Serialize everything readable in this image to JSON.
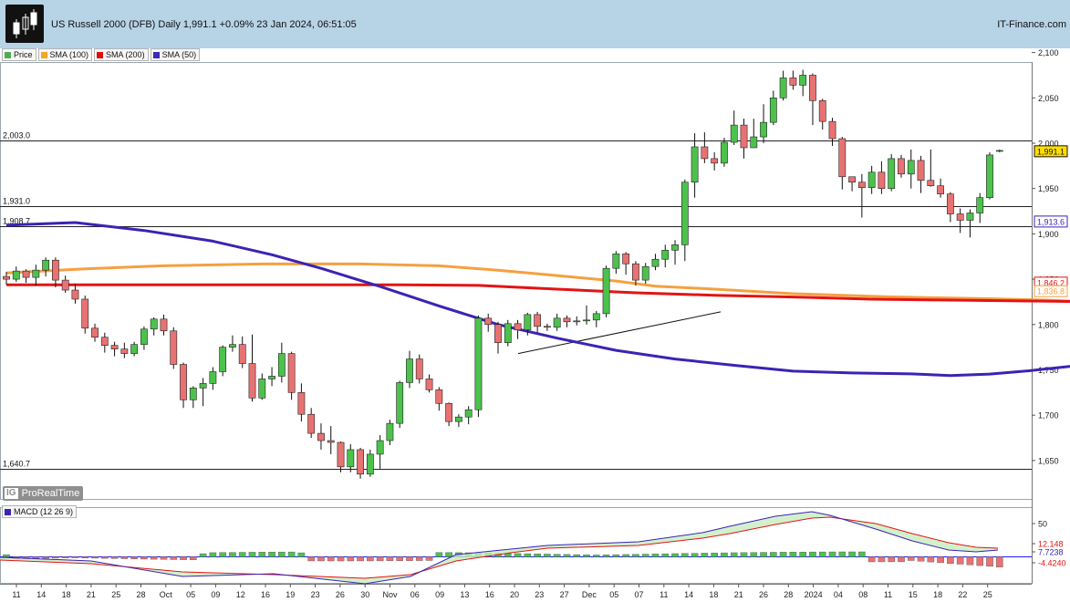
{
  "header": {
    "title": "US Russell 2000 (DFB) Daily 1,991.1 +0.09% 23 Jan 2024, 06:51:05",
    "brand": "IT-Finance.com"
  },
  "legend": [
    {
      "label": "Price",
      "color": "#4caf50"
    },
    {
      "label": "SMA (100)",
      "color": "#f5a623"
    },
    {
      "label": "SMA (200)",
      "color": "#e01010"
    },
    {
      "label": "SMA (50)",
      "color": "#3b2bb5"
    }
  ],
  "watermark": {
    "badge": "IG",
    "text": "ProRealTime"
  },
  "macd_label": "MACD (12 26 9)",
  "colors": {
    "up": "#4cc24c",
    "down": "#e87272",
    "sma50": "#3b23b4",
    "sma100": "#f5a040",
    "sma200": "#e31414"
  },
  "chart_data": [
    {
      "type": "candlestick",
      "title": "US Russell 2000 (DFB) Daily",
      "y_range": [
        1620,
        2120
      ],
      "y_ticks": [
        "2,100",
        "2,050",
        "2,000",
        "1,950",
        "1,900",
        "1,850",
        "1,800",
        "1,750",
        "1,700",
        "1,650"
      ],
      "x_ticks": [
        "11",
        "14",
        "18",
        "21",
        "25",
        "28",
        "Oct",
        "05",
        "09",
        "12",
        "16",
        "19",
        "23",
        "26",
        "30",
        "Nov",
        "06",
        "09",
        "13",
        "16",
        "20",
        "23",
        "27",
        "Dec",
        "05",
        "07",
        "11",
        "14",
        "18",
        "21",
        "26",
        "28",
        "2024",
        "04",
        "08",
        "11",
        "15",
        "18",
        "22",
        "25"
      ],
      "horizontal_levels": [
        {
          "label": "2,003.0",
          "value": 2003.0
        },
        {
          "label": "1,931.0",
          "value": 1931.0
        },
        {
          "label": "1,908.7",
          "value": 1908.7
        },
        {
          "label": "1,640.7",
          "value": 1640.7
        }
      ],
      "right_labels": [
        {
          "text": "1,991.1",
          "value": 1991.1
        },
        {
          "text": "1,913.6",
          "value": 1913.6
        },
        {
          "text": "1,846.2",
          "value": 1846.2
        },
        {
          "text": "1,836.8",
          "value": 1836.8
        }
      ],
      "trendline": [
        [
          1768,
          1812
        ],
        [
          1766,
          1816
        ]
      ],
      "candles": [
        [
          1853,
          1850,
          1858,
          1844
        ],
        [
          1850,
          1859,
          1864,
          1847
        ],
        [
          1859,
          1852,
          1861,
          1846
        ],
        [
          1852,
          1860,
          1866,
          1843
        ],
        [
          1860,
          1871,
          1874,
          1853
        ],
        [
          1871,
          1849,
          1874,
          1841
        ],
        [
          1849,
          1838,
          1854,
          1835
        ],
        [
          1838,
          1828,
          1845,
          1823
        ],
        [
          1828,
          1796,
          1832,
          1790
        ],
        [
          1796,
          1786,
          1801,
          1781
        ],
        [
          1786,
          1777,
          1791,
          1769
        ],
        [
          1777,
          1773,
          1781,
          1765
        ],
        [
          1773,
          1768,
          1780,
          1763
        ],
        [
          1768,
          1778,
          1781,
          1765
        ],
        [
          1778,
          1795,
          1798,
          1772
        ],
        [
          1795,
          1806,
          1808,
          1788
        ],
        [
          1806,
          1793,
          1811,
          1788
        ],
        [
          1793,
          1756,
          1797,
          1751
        ],
        [
          1756,
          1717,
          1758,
          1708
        ],
        [
          1717,
          1730,
          1732,
          1708
        ],
        [
          1730,
          1735,
          1741,
          1710
        ],
        [
          1735,
          1748,
          1753,
          1728
        ],
        [
          1748,
          1775,
          1777,
          1743
        ],
        [
          1775,
          1778,
          1788,
          1770
        ],
        [
          1778,
          1757,
          1787,
          1752
        ],
        [
          1757,
          1719,
          1789,
          1715
        ],
        [
          1719,
          1740,
          1746,
          1717
        ],
        [
          1740,
          1743,
          1753,
          1732
        ],
        [
          1743,
          1768,
          1780,
          1736
        ],
        [
          1768,
          1725,
          1770,
          1717
        ],
        [
          1725,
          1701,
          1735,
          1693
        ],
        [
          1701,
          1680,
          1708,
          1675
        ],
        [
          1680,
          1672,
          1691,
          1662
        ],
        [
          1672,
          1670,
          1688,
          1657
        ],
        [
          1670,
          1643,
          1671,
          1637
        ],
        [
          1643,
          1662,
          1668,
          1637
        ],
        [
          1662,
          1635,
          1664,
          1630
        ],
        [
          1635,
          1657,
          1662,
          1632
        ],
        [
          1657,
          1672,
          1678,
          1641
        ],
        [
          1672,
          1691,
          1695,
          1667
        ],
        [
          1691,
          1736,
          1738,
          1686
        ],
        [
          1736,
          1762,
          1771,
          1730
        ],
        [
          1762,
          1740,
          1767,
          1735
        ],
        [
          1740,
          1728,
          1745,
          1725
        ],
        [
          1728,
          1713,
          1731,
          1705
        ],
        [
          1713,
          1693,
          1714,
          1688
        ],
        [
          1693,
          1698,
          1701,
          1687
        ],
        [
          1698,
          1706,
          1710,
          1690
        ],
        [
          1706,
          1807,
          1810,
          1698
        ],
        [
          1807,
          1800,
          1812,
          1792
        ],
        [
          1800,
          1780,
          1803,
          1768
        ],
        [
          1780,
          1801,
          1805,
          1776
        ],
        [
          1801,
          1794,
          1805,
          1784
        ],
        [
          1794,
          1811,
          1813,
          1788
        ],
        [
          1811,
          1798,
          1814,
          1791
        ],
        [
          1798,
          1797,
          1801,
          1793
        ],
        [
          1797,
          1807,
          1812,
          1793
        ],
        [
          1807,
          1803,
          1810,
          1797
        ],
        [
          1803,
          1804,
          1809,
          1799
        ],
        [
          1804,
          1805,
          1821,
          1800
        ],
        [
          1805,
          1812,
          1815,
          1797
        ],
        [
          1812,
          1862,
          1865,
          1808
        ],
        [
          1862,
          1878,
          1881,
          1856
        ],
        [
          1878,
          1867,
          1880,
          1855
        ],
        [
          1867,
          1849,
          1870,
          1843
        ],
        [
          1849,
          1864,
          1868,
          1845
        ],
        [
          1864,
          1872,
          1878,
          1860
        ],
        [
          1872,
          1882,
          1888,
          1863
        ],
        [
          1882,
          1888,
          1893,
          1866
        ],
        [
          1888,
          1957,
          1960,
          1870
        ],
        [
          1957,
          1996,
          2011,
          1940
        ],
        [
          1996,
          1983,
          2012,
          1978
        ],
        [
          1983,
          1978,
          1990,
          1970
        ],
        [
          1978,
          2001,
          2006,
          1974
        ],
        [
          2001,
          2020,
          2036,
          1998
        ],
        [
          2020,
          1995,
          2027,
          1983
        ],
        [
          1995,
          2007,
          2027,
          2001
        ],
        [
          2007,
          2023,
          2043,
          2000
        ],
        [
          2023,
          2050,
          2058,
          2020
        ],
        [
          2050,
          2072,
          2080,
          2047
        ],
        [
          2072,
          2064,
          2080,
          2059
        ],
        [
          2064,
          2075,
          2081,
          2052
        ],
        [
          2075,
          2047,
          2077,
          2020
        ],
        [
          2047,
          2024,
          2049,
          2015
        ],
        [
          2024,
          2005,
          2028,
          1997
        ],
        [
          2005,
          1963,
          2007,
          1949
        ],
        [
          1963,
          1957,
          1961,
          1947
        ],
        [
          1957,
          1951,
          1966,
          1918
        ],
        [
          1951,
          1968,
          1975,
          1944
        ],
        [
          1968,
          1950,
          1980,
          1944
        ],
        [
          1950,
          1983,
          1988,
          1947
        ],
        [
          1983,
          1966,
          1987,
          1962
        ],
        [
          1966,
          1981,
          1993,
          1950
        ],
        [
          1981,
          1959,
          1986,
          1945
        ],
        [
          1959,
          1953,
          1993,
          1952
        ],
        [
          1953,
          1944,
          1961,
          1940
        ],
        [
          1944,
          1922,
          1946,
          1913
        ],
        [
          1922,
          1915,
          1928,
          1901
        ],
        [
          1915,
          1923,
          1927,
          1896
        ],
        [
          1923,
          1940,
          1945,
          1912
        ],
        [
          1940,
          1987,
          1990,
          1938
        ],
        [
          1991,
          1992,
          1993,
          1990
        ]
      ],
      "sma50": [
        [
          1909.6,
          0
        ],
        [
          1912.5,
          7
        ],
        [
          1903.7,
          14
        ],
        [
          1892,
          21
        ],
        [
          1877,
          27
        ],
        [
          1862,
          32
        ],
        [
          1842,
          38
        ],
        [
          1820.5,
          44
        ],
        [
          1800,
          50
        ],
        [
          1785,
          56
        ],
        [
          1771.5,
          62
        ],
        [
          1762,
          68
        ],
        [
          1755,
          74
        ],
        [
          1748.6,
          80
        ],
        [
          1746.6,
          86
        ],
        [
          1745.6,
          92
        ],
        [
          1743.8,
          96
        ],
        [
          1745.4,
          100
        ],
        [
          1749,
          104
        ],
        [
          1753.6,
          108
        ],
        [
          1760,
          112
        ],
        [
          1770,
          116
        ],
        [
          1778,
          120
        ],
        [
          1790,
          124
        ],
        [
          1808,
          128
        ],
        [
          1820,
          132
        ],
        [
          1834,
          136
        ],
        [
          1846,
          140
        ],
        [
          1860,
          144
        ],
        [
          1871,
          148
        ],
        [
          1878,
          152
        ],
        [
          1888,
          156
        ],
        [
          1894,
          160
        ],
        [
          1896,
          164
        ],
        [
          1902,
          168
        ],
        [
          1913.6,
          172
        ]
      ],
      "sma100": [
        [
          1856.8,
          0
        ],
        [
          1861.5,
          8
        ],
        [
          1864.8,
          16
        ],
        [
          1866.8,
          26
        ],
        [
          1866.8,
          36
        ],
        [
          1864.8,
          44
        ],
        [
          1860,
          50
        ],
        [
          1854,
          56
        ],
        [
          1848,
          62
        ],
        [
          1842.4,
          66
        ],
        [
          1839,
          72
        ],
        [
          1834,
          80
        ],
        [
          1830.5,
          90
        ],
        [
          1828.5,
          100
        ],
        [
          1826.9,
          106
        ],
        [
          1825,
          110
        ],
        [
          1821.4,
          116
        ],
        [
          1819,
          126
        ],
        [
          1816.9,
          136
        ],
        [
          1815,
          144
        ],
        [
          1817.8,
          152
        ],
        [
          1822.4,
          158
        ],
        [
          1826.1,
          162
        ],
        [
          1828.3,
          166
        ],
        [
          1830.5,
          170
        ],
        [
          1836.8,
          172
        ]
      ],
      "sma200": [
        [
          1843.8,
          0
        ],
        [
          1843.8,
          20
        ],
        [
          1843.8,
          40
        ],
        [
          1843.2,
          48
        ],
        [
          1839,
          56
        ],
        [
          1835,
          64
        ],
        [
          1832.3,
          72
        ],
        [
          1830.4,
          80
        ],
        [
          1828,
          88
        ],
        [
          1827,
          96
        ],
        [
          1826,
          104
        ],
        [
          1824.9,
          112
        ],
        [
          1825.6,
          118
        ],
        [
          1827,
          122
        ],
        [
          1830.5,
          128
        ],
        [
          1832.8,
          134
        ],
        [
          1835,
          140
        ],
        [
          1837,
          146
        ],
        [
          1839,
          152
        ],
        [
          1841,
          158
        ],
        [
          1843,
          164
        ],
        [
          1846.2,
          172
        ]
      ],
      "macd_ticks": [
        "50",
        "12.148",
        "7.7238",
        "-4.4240"
      ]
    }
  ]
}
